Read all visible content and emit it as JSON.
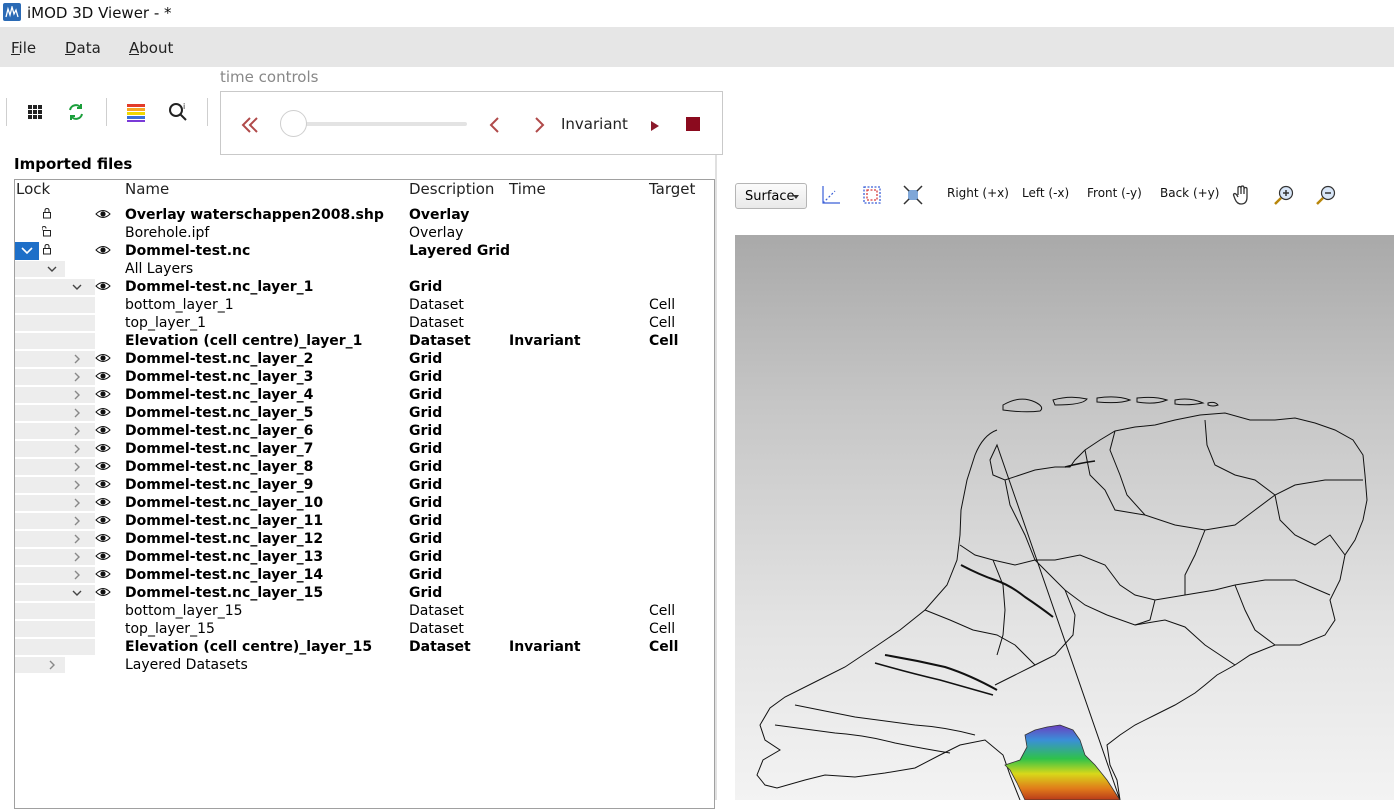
{
  "window": {
    "title": "iMOD 3D Viewer   -      *"
  },
  "menu": {
    "items": [
      "File",
      "Data",
      "About"
    ]
  },
  "toolbar": {
    "buttons": [
      "grid-icon",
      "refresh-icon",
      "colormap-icon",
      "query-icon"
    ]
  },
  "time_controls": {
    "label": "time controls",
    "time_value": "Invariant",
    "slider_value": 0
  },
  "files": {
    "title": "Imported files",
    "columns": {
      "lock": "Lock",
      "name": "Name",
      "description": "Description",
      "time": "Time",
      "target": "Target"
    },
    "rows": [
      {
        "name": "Overlay waterschappen2008.shp",
        "desc": "Overlay",
        "time": "",
        "target": ""
      },
      {
        "name": "Borehole.ipf",
        "desc": "Overlay",
        "time": "",
        "target": ""
      },
      {
        "name": "Dommel-test.nc",
        "desc": "Layered Grid",
        "time": "",
        "target": ""
      },
      {
        "name": "All Layers",
        "desc": "",
        "time": "",
        "target": ""
      },
      {
        "name": "Dommel-test.nc_layer_1",
        "desc": "Grid",
        "time": "",
        "target": ""
      },
      {
        "name": "bottom_layer_1",
        "desc": "Dataset",
        "time": "",
        "target": "Cell"
      },
      {
        "name": "top_layer_1",
        "desc": "Dataset",
        "time": "",
        "target": "Cell"
      },
      {
        "name": "Elevation (cell centre)_layer_1",
        "desc": "Dataset",
        "time": "Invariant",
        "target": "Cell"
      },
      {
        "name": "Dommel-test.nc_layer_2",
        "desc": "Grid",
        "time": "",
        "target": ""
      },
      {
        "name": "Dommel-test.nc_layer_3",
        "desc": "Grid",
        "time": "",
        "target": ""
      },
      {
        "name": "Dommel-test.nc_layer_4",
        "desc": "Grid",
        "time": "",
        "target": ""
      },
      {
        "name": "Dommel-test.nc_layer_5",
        "desc": "Grid",
        "time": "",
        "target": ""
      },
      {
        "name": "Dommel-test.nc_layer_6",
        "desc": "Grid",
        "time": "",
        "target": ""
      },
      {
        "name": "Dommel-test.nc_layer_7",
        "desc": "Grid",
        "time": "",
        "target": ""
      },
      {
        "name": "Dommel-test.nc_layer_8",
        "desc": "Grid",
        "time": "",
        "target": ""
      },
      {
        "name": "Dommel-test.nc_layer_9",
        "desc": "Grid",
        "time": "",
        "target": ""
      },
      {
        "name": "Dommel-test.nc_layer_10",
        "desc": "Grid",
        "time": "",
        "target": ""
      },
      {
        "name": "Dommel-test.nc_layer_11",
        "desc": "Grid",
        "time": "",
        "target": ""
      },
      {
        "name": "Dommel-test.nc_layer_12",
        "desc": "Grid",
        "time": "",
        "target": ""
      },
      {
        "name": "Dommel-test.nc_layer_13",
        "desc": "Grid",
        "time": "",
        "target": ""
      },
      {
        "name": "Dommel-test.nc_layer_14",
        "desc": "Grid",
        "time": "",
        "target": ""
      },
      {
        "name": "Dommel-test.nc_layer_15",
        "desc": "Grid",
        "time": "",
        "target": ""
      },
      {
        "name": "bottom_layer_15",
        "desc": "Dataset",
        "time": "",
        "target": "Cell"
      },
      {
        "name": "top_layer_15",
        "desc": "Dataset",
        "time": "",
        "target": "Cell"
      },
      {
        "name": "Elevation (cell centre)_layer_15",
        "desc": "Dataset",
        "time": "Invariant",
        "target": "Cell"
      },
      {
        "name": "Layered Datasets",
        "desc": "",
        "time": "",
        "target": ""
      }
    ]
  },
  "viewer_toolbar": {
    "surface_mode": "Surface",
    "views": [
      "Right (+x)",
      "Left (-x)",
      "Front (-y)",
      "Back (+y)"
    ],
    "icons": [
      "axes-icon",
      "bounding-box-icon",
      "fit-view-icon",
      "pan-hand-icon",
      "zoom-in-icon",
      "zoom-out-icon"
    ]
  },
  "colors": {
    "accent": "#1e6fc8",
    "play": "#8b1a2b",
    "stop": "#8b0a1e",
    "refresh": "#1a9e3a"
  }
}
